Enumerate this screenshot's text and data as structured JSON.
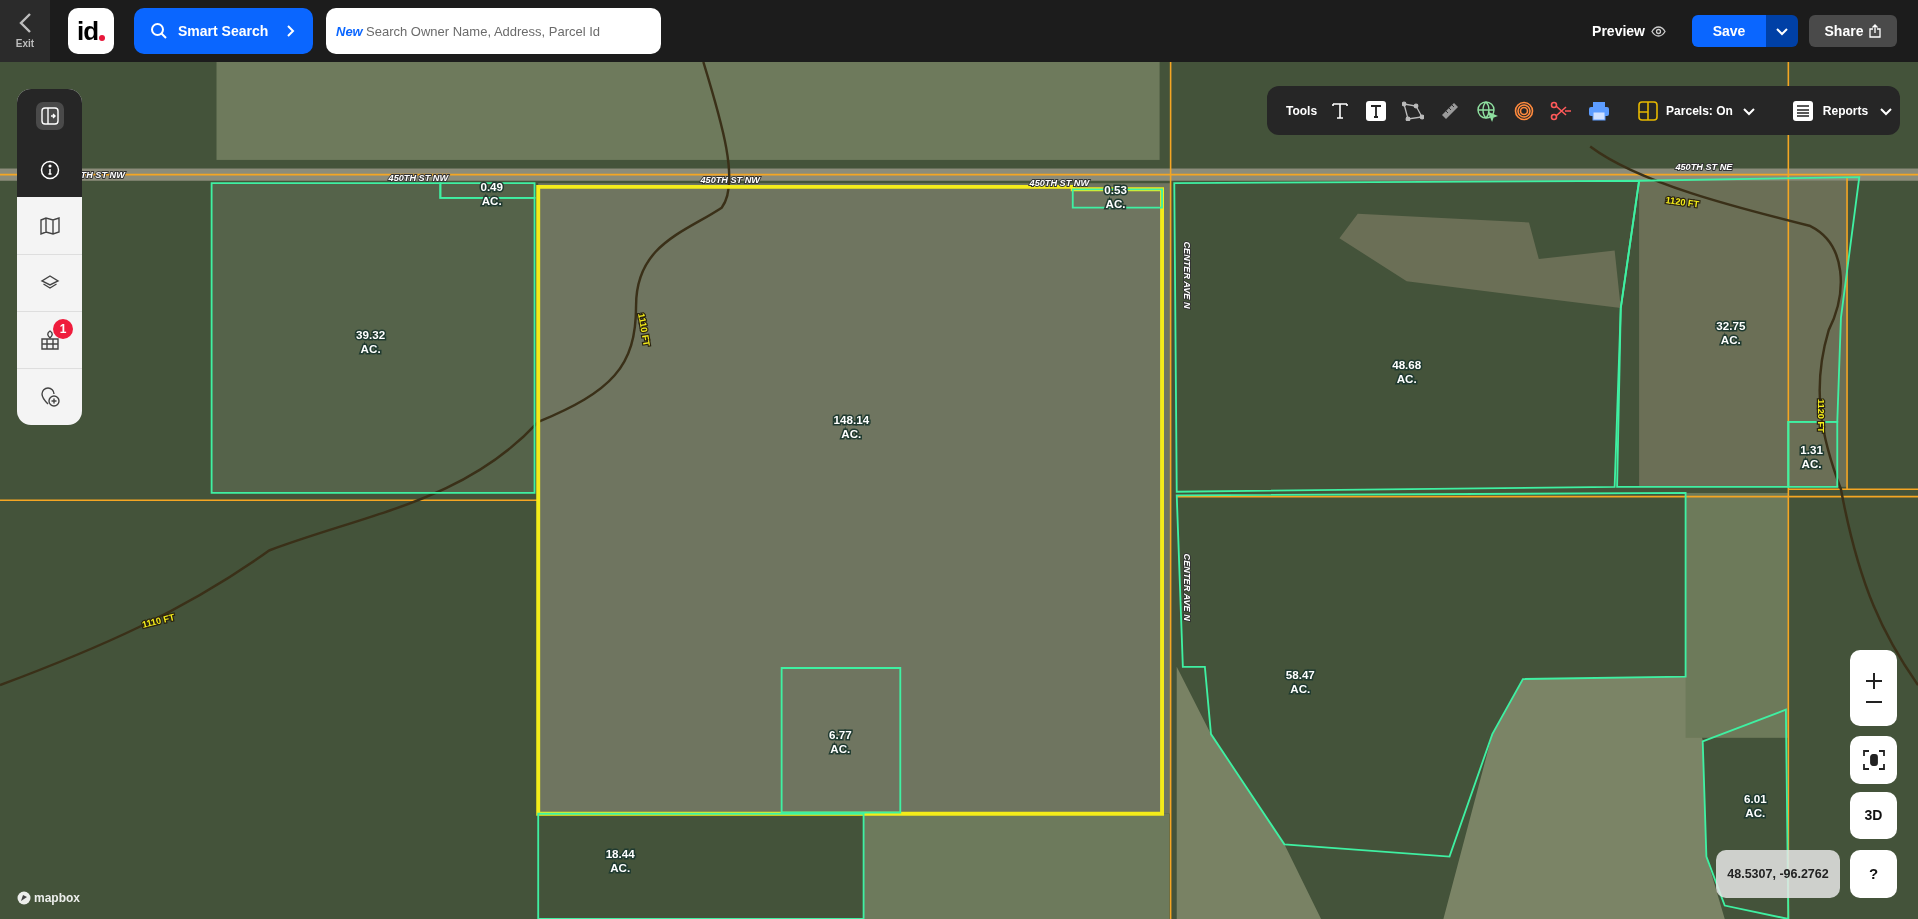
{
  "topbar": {
    "exit_label": "Exit",
    "logo_text": "id",
    "smart_search": "Smart Search",
    "search": {
      "badge": "New",
      "placeholder": "Search Owner Name, Address, Parcel Id"
    },
    "preview": "Preview",
    "save": "Save",
    "share": "Share"
  },
  "toolbar": {
    "label": "Tools",
    "parcels_toggle": "Parcels: On",
    "reports": "Reports"
  },
  "sidebar": {
    "items": [
      {
        "kind": "panel"
      },
      {
        "kind": "info"
      },
      {
        "kind": "map"
      },
      {
        "kind": "layers"
      },
      {
        "kind": "parcels",
        "badge": "1"
      },
      {
        "kind": "add-place"
      }
    ]
  },
  "map": {
    "parcels": [
      {
        "area": "39.32",
        "unit": "AC.",
        "selected": false
      },
      {
        "area": "0.49",
        "unit": "AC.",
        "selected": false
      },
      {
        "area": "148.14",
        "unit": "AC.",
        "selected": true
      },
      {
        "area": "0.53",
        "unit": "AC.",
        "selected": false
      },
      {
        "area": "48.68",
        "unit": "AC.",
        "selected": false
      },
      {
        "area": "32.75",
        "unit": "AC.",
        "selected": false
      },
      {
        "area": "1.31",
        "unit": "AC.",
        "selected": false
      },
      {
        "area": "6.77",
        "unit": "AC.",
        "selected": false
      },
      {
        "area": "58.47",
        "unit": "AC.",
        "selected": false
      },
      {
        "area": "18.44",
        "unit": "AC.",
        "selected": false
      },
      {
        "area": "6.01",
        "unit": "AC.",
        "selected": false
      }
    ],
    "roads": [
      {
        "label": "TH ST NW"
      },
      {
        "label": "450TH ST NW"
      },
      {
        "label": "450TH ST NW"
      },
      {
        "label": "450TH ST NW"
      },
      {
        "label": "450TH ST NE"
      },
      {
        "label": "CENTER AVE N"
      },
      {
        "label": "CENTER AVE N"
      }
    ],
    "contours": [
      {
        "label": "1110 FT"
      },
      {
        "label": "1110 FT"
      },
      {
        "label": "1120 FT"
      },
      {
        "label": "1120 FT"
      }
    ],
    "attribution": "mapbox"
  },
  "controls": {
    "three_d": "3D",
    "help": "?",
    "coordinates": "48.5307, -96.2762"
  }
}
